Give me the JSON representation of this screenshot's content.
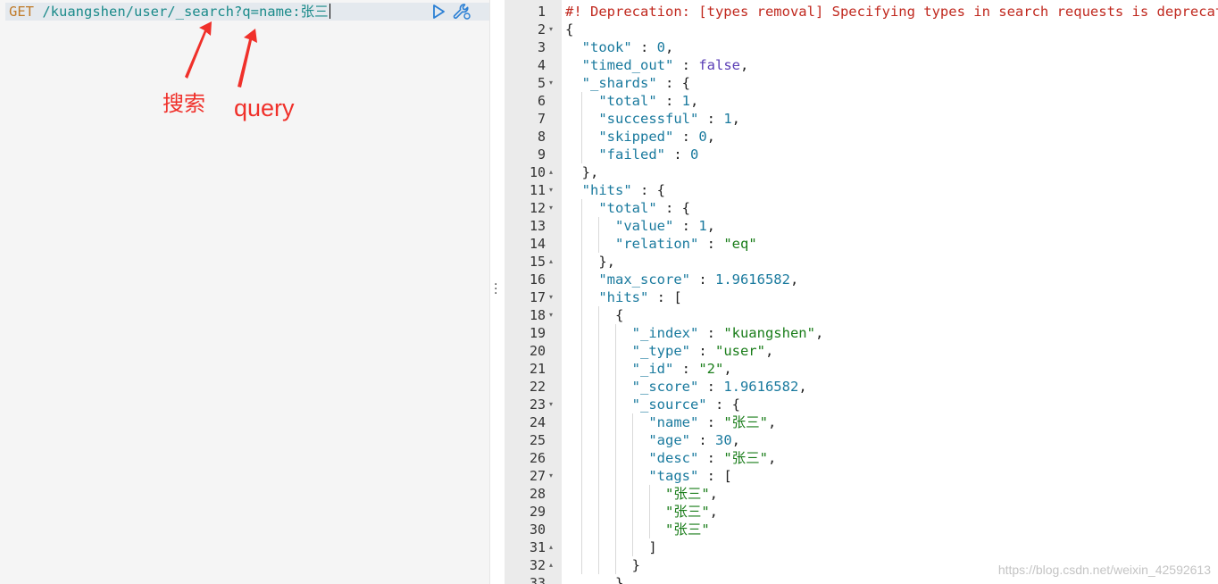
{
  "request": {
    "method": "GET",
    "path": " /kuangshen/user/_search?q=name:张三",
    "run_icon": "play-icon",
    "settings_icon": "wrench-icon"
  },
  "annotations": {
    "search_label": "搜索",
    "query_label": "query",
    "color": "#f0302a"
  },
  "splitter": {
    "handle": "⋮"
  },
  "response": {
    "lines": [
      {
        "n": "1",
        "f": "",
        "html": "<span class=\"warn\">#! Deprecation: [types removal] Specifying types in search requests is deprecated.</span>"
      },
      {
        "n": "2",
        "f": "▾",
        "html": "{"
      },
      {
        "n": "3",
        "f": "",
        "html": "  <span class=\"k\">\"took\"</span> : <span class=\"n\">0</span>,"
      },
      {
        "n": "4",
        "f": "",
        "html": "  <span class=\"k\">\"timed_out\"</span> : <span class=\"b\">false</span>,"
      },
      {
        "n": "5",
        "f": "▾",
        "html": "  <span class=\"k\">\"_shards\"</span> : {"
      },
      {
        "n": "6",
        "f": "",
        "html": "    <span class=\"k\">\"total\"</span> : <span class=\"n\">1</span>,"
      },
      {
        "n": "7",
        "f": "",
        "html": "    <span class=\"k\">\"successful\"</span> : <span class=\"n\">1</span>,"
      },
      {
        "n": "8",
        "f": "",
        "html": "    <span class=\"k\">\"skipped\"</span> : <span class=\"n\">0</span>,"
      },
      {
        "n": "9",
        "f": "",
        "html": "    <span class=\"k\">\"failed\"</span> : <span class=\"n\">0</span>"
      },
      {
        "n": "10",
        "f": "▴",
        "html": "  },"
      },
      {
        "n": "11",
        "f": "▾",
        "html": "  <span class=\"k\">\"hits\"</span> : {"
      },
      {
        "n": "12",
        "f": "▾",
        "html": "    <span class=\"k\">\"total\"</span> : {"
      },
      {
        "n": "13",
        "f": "",
        "html": "      <span class=\"k\">\"value\"</span> : <span class=\"n\">1</span>,"
      },
      {
        "n": "14",
        "f": "",
        "html": "      <span class=\"k\">\"relation\"</span> : <span class=\"s\">\"eq\"</span>"
      },
      {
        "n": "15",
        "f": "▴",
        "html": "    },"
      },
      {
        "n": "16",
        "f": "",
        "html": "    <span class=\"k\">\"max_score\"</span> : <span class=\"n\">1.9616582</span>,"
      },
      {
        "n": "17",
        "f": "▾",
        "html": "    <span class=\"k\">\"hits\"</span> : ["
      },
      {
        "n": "18",
        "f": "▾",
        "html": "      {"
      },
      {
        "n": "19",
        "f": "",
        "html": "        <span class=\"k\">\"_index\"</span> : <span class=\"s\">\"kuangshen\"</span>,"
      },
      {
        "n": "20",
        "f": "",
        "html": "        <span class=\"k\">\"_type\"</span> : <span class=\"s\">\"user\"</span>,"
      },
      {
        "n": "21",
        "f": "",
        "html": "        <span class=\"k\">\"_id\"</span> : <span class=\"s\">\"2\"</span>,"
      },
      {
        "n": "22",
        "f": "",
        "html": "        <span class=\"k\">\"_score\"</span> : <span class=\"n\">1.9616582</span>,"
      },
      {
        "n": "23",
        "f": "▾",
        "html": "        <span class=\"k\">\"_source\"</span> : {"
      },
      {
        "n": "24",
        "f": "",
        "html": "          <span class=\"k\">\"name\"</span> : <span class=\"s\">\"张三\"</span>,"
      },
      {
        "n": "25",
        "f": "",
        "html": "          <span class=\"k\">\"age\"</span> : <span class=\"n\">30</span>,"
      },
      {
        "n": "26",
        "f": "",
        "html": "          <span class=\"k\">\"desc\"</span> : <span class=\"s\">\"张三\"</span>,"
      },
      {
        "n": "27",
        "f": "▾",
        "html": "          <span class=\"k\">\"tags\"</span> : ["
      },
      {
        "n": "28",
        "f": "",
        "html": "            <span class=\"s\">\"张三\"</span>,"
      },
      {
        "n": "29",
        "f": "",
        "html": "            <span class=\"s\">\"张三\"</span>,"
      },
      {
        "n": "30",
        "f": "",
        "html": "            <span class=\"s\">\"张三\"</span>"
      },
      {
        "n": "31",
        "f": "▴",
        "html": "          ]"
      },
      {
        "n": "32",
        "f": "▴",
        "html": "        }"
      },
      {
        "n": "33",
        "f": "",
        "html": "      }"
      }
    ]
  },
  "watermark": "https://blog.csdn.net/weixin_42592613"
}
